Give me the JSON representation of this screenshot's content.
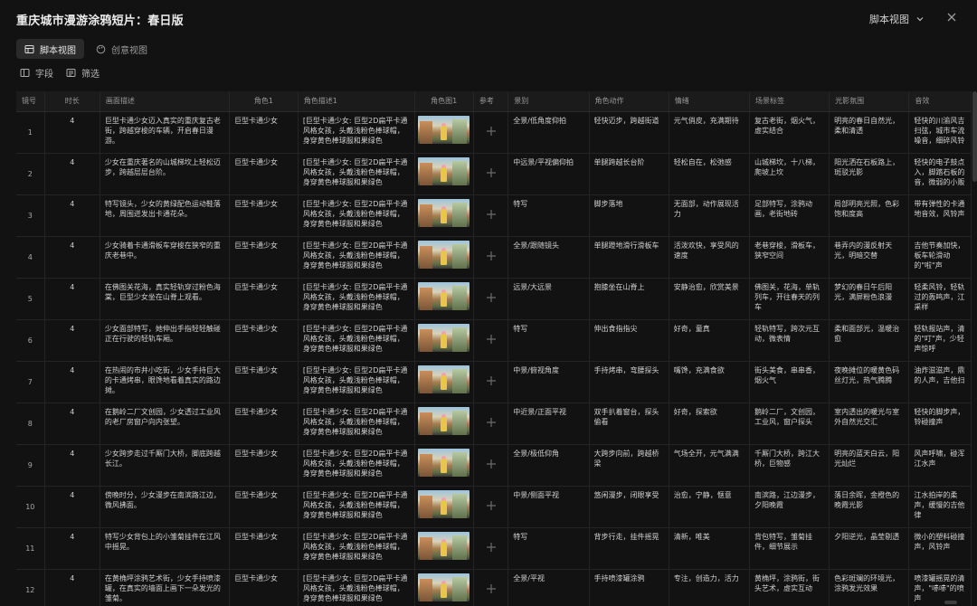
{
  "window": {
    "title": "重庆城市漫游涂鸦短片：春日版",
    "view_selector": "脚本视图"
  },
  "tabs": [
    {
      "label": "脚本视图",
      "icon": "table-icon",
      "active": true
    },
    {
      "label": "创意视图",
      "icon": "palette-icon",
      "active": false
    }
  ],
  "toolbar": {
    "fields_label": "字段",
    "filter_label": "筛选"
  },
  "columns": [
    "镜号",
    "时长",
    "画面描述",
    "角色1",
    "角色描述1",
    "角色图1",
    "参考",
    "景别",
    "角色动作",
    "情绪",
    "场景标签",
    "光影氛围",
    "音效"
  ],
  "rows": [
    {
      "no": "1",
      "dur": "4",
      "desc": "巨型卡通少女迈入真实的重庆复古老街，跨越穿梭的车辆，开启春日漫游。",
      "role": "巨型卡通少女",
      "roledesc": "[巨型卡通少女: 巨型2D扁平卡通风格女孩，头戴浅粉色棒球帽，身穿黄色棒球服和果绿色",
      "shot": "全景/低角度仰拍",
      "action": "轻快迈步，跨越街道",
      "emotion": "元气俏皮，充满期待",
      "scene": "复古老街，烟火气，虚实结合",
      "light": "明亮的春日自然光，柔和清透",
      "sound": "轻快的川渝风吉扫弦，城市车流噪音，细碎风铃"
    },
    {
      "no": "2",
      "dur": "4",
      "desc": "少女在重庆著名的山城梯坎上轻松迈步，跨越层层台阶。",
      "role": "巨型卡通少女",
      "roledesc": "[巨型卡通少女: 巨型2D扁平卡通风格女孩，头戴浅粉色棒球帽，身穿黄色棒球服和果绿色",
      "shot": "中远景/平视偏仰拍",
      "action": "单腿跨越长台阶",
      "emotion": "轻松自在，松弛感",
      "scene": "山城梯坎，十八梯，爬坡上坎",
      "light": "阳光洒在石板路上，斑驳光影",
      "sound": "轻快的电子鼓点入，脚踏石板的音，微弱的小贩"
    },
    {
      "no": "3",
      "dur": "4",
      "desc": "特写镜头，少女的黄绿配色运动鞋落地，周围迸发出卡通花朵。",
      "role": "巨型卡通少女",
      "roledesc": "[巨型卡通少女: 巨型2D扁平卡通风格女孩，头戴浅粉色棒球帽，身穿黄色棒球服和果绿色",
      "shot": "特写",
      "action": "脚步落地",
      "emotion": "无面部，动作展现活力",
      "scene": "足部特写，涂鸦动画，老街地砖",
      "light": "局部明亮光照，色彩饱和度高",
      "sound": "带有弹性的卡通地音效，风铃声"
    },
    {
      "no": "4",
      "dur": "4",
      "desc": "少女骑着卡通滑板车穿梭在狭窄的重庆老巷中。",
      "role": "巨型卡通少女",
      "roledesc": "[巨型卡通少女: 巨型2D扁平卡通风格女孩，头戴浅粉色棒球帽，身穿黄色棒球服和果绿色",
      "shot": "全景/跟随镜头",
      "action": "单腿蹬地滑行滑板车",
      "emotion": "活泼欢快，享受风的速度",
      "scene": "老巷穿梭，滑板车，狭窄空间",
      "light": "巷弄内的漫反射天光，明暗交替",
      "sound": "吉他节奏加快，板车轮滑动的\"啦\"声"
    },
    {
      "no": "5",
      "dur": "4",
      "desc": "在佛图关花海，真实轻轨穿过粉色海棠，巨型少女坐在山脊上观看。",
      "role": "巨型卡通少女",
      "roledesc": "[巨型卡通少女: 巨型2D扁平卡通风格女孩，头戴浅粉色棒球帽，身穿黄色棒球服和果绿色",
      "shot": "远景/大远景",
      "action": "抱膝坐在山脊上",
      "emotion": "安静治愈，欣赏美景",
      "scene": "佛图关，花海，单轨列车，开往春天的列车",
      "light": "梦幻的春日午后阳光，满屏粉色浪漫",
      "sound": "轻柔风铃，轻轨过的轰鸣声，江采样"
    },
    {
      "no": "6",
      "dur": "4",
      "desc": "少女面部特写，她伸出手指轻轻触碰正在行驶的轻轨车厢。",
      "role": "巨型卡通少女",
      "roledesc": "[巨型卡通少女: 巨型2D扁平卡通风格女孩，头戴浅粉色棒球帽，身穿黄色棒球服和果绿色",
      "shot": "特写",
      "action": "伸出食指指尖",
      "emotion": "好奇，童真",
      "scene": "轻轨特写，跨次元互动，微表情",
      "light": "柔和面部光，温暖治愈",
      "sound": "轻轨报站声，清的\"叮\"声，少轻声惊呼"
    },
    {
      "no": "7",
      "dur": "4",
      "desc": "在热闹的市井小吃街，少女手持巨大的卡通烤串，眼馋地看着真实的路边摊。",
      "role": "巨型卡通少女",
      "roledesc": "[巨型卡通少女: 巨型2D扁平卡通风格女孩，头戴浅粉色棒球帽，身穿黄色棒球服和果绿色",
      "shot": "中景/俯视角度",
      "action": "手持烤串，弯腰探头",
      "emotion": "嘴馋，充满食欲",
      "scene": "街头美食，串串香，烟火气",
      "light": "夜晚摊位的暖黄色码丝灯光，热气腾腾",
      "sound": "油炸滋滋声，鼎的人声，吉他扫"
    },
    {
      "no": "8",
      "dur": "4",
      "desc": "在鹅岭二厂文创园，少女透过工业风的老厂房窗户向内张望。",
      "role": "巨型卡通少女",
      "roledesc": "[巨型卡通少女: 巨型2D扁平卡通风格女孩，头戴浅粉色棒球帽，身穿黄色棒球服和果绿色",
      "shot": "中近景/正面平视",
      "action": "双手扒着窗台，探头偷看",
      "emotion": "好奇，探索欲",
      "scene": "鹅岭二厂，文创园，工业风，窗户探头",
      "light": "室内透出的暖光与室外自然光交汇",
      "sound": "轻快的脚步声，铃碰撞声"
    },
    {
      "no": "9",
      "dur": "4",
      "desc": "少女跨步走过千厮门大桥，脚底跨越长江。",
      "role": "巨型卡通少女",
      "roledesc": "[巨型卡通少女: 巨型2D扁平卡通风格女孩，头戴浅粉色棒球帽，身穿黄色棒球服和果绿色",
      "shot": "全景/极低仰角",
      "action": "大跨步向前，跨越桥梁",
      "emotion": "气场全开，元气满满",
      "scene": "千厮门大桥，跨江大桥，巨物感",
      "light": "明亮的蓝天白云，阳光灿烂",
      "sound": "风声呼啸，碰浑江水声"
    },
    {
      "no": "10",
      "dur": "4",
      "desc": "傍晚时分，少女漫步在南滨路江边，微风拂面。",
      "role": "巨型卡通少女",
      "roledesc": "[巨型卡通少女: 巨型2D扁平卡通风格女孩，头戴浅粉色棒球帽，身穿黄色棒球服和果绿色",
      "shot": "中景/侧面平视",
      "action": "悠闲漫步，闭眼享受",
      "emotion": "治愈，宁静，惬意",
      "scene": "南滨路，江边漫步，夕阳晚霞",
      "light": "落日余晖，金橙色的晚霞光影",
      "sound": "江水拍岸的柔声，缓慢的吉他律"
    },
    {
      "no": "11",
      "dur": "4",
      "desc": "特写少女背包上的小雏菊挂件在江风中摇晃。",
      "role": "巨型卡通少女",
      "roledesc": "[巨型卡通少女: 巨型2D扁平卡通风格女孩，头戴浅粉色棒球帽，身穿黄色棒球服和果绿色",
      "shot": "特写",
      "action": "背步行走，挂件摇晃",
      "emotion": "清新，唯美",
      "scene": "背包特写，雏菊挂件，细节展示",
      "light": "夕阳逆光，晶莹剔透",
      "sound": "微小的塑料碰撞声，风铃声"
    },
    {
      "no": "12",
      "dur": "4",
      "desc": "在黄桷坪涂鸦艺术街，少女手持喷漆罐，在真实的墙面上画下一朵发光的雏菊。",
      "role": "巨型卡通少女",
      "roledesc": "[巨型卡通少女: 巨型2D扁平卡通风格女孩，头戴浅粉色棒球帽，身穿黄色棒球服和果绿色",
      "shot": "全景/平视",
      "action": "手持喷漆罐涂鸦",
      "emotion": "专注，创造力，活力",
      "scene": "黄桷坪，涂鸦街，街头艺术，虚实互动",
      "light": "色彩斑斓的环境光，涂鸦发光效果",
      "sound": "喷漆罐摇晃的清声，\"哧哧\"的喷声"
    }
  ]
}
